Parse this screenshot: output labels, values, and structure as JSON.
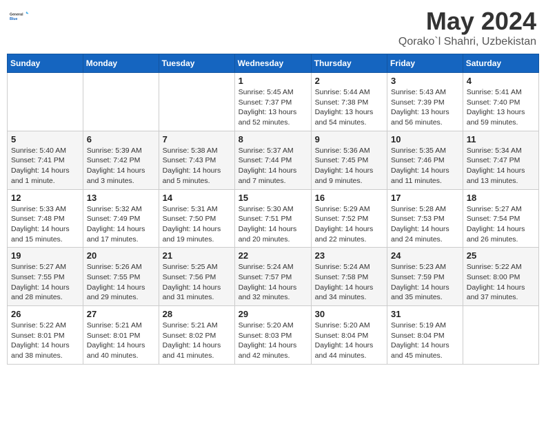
{
  "logo": {
    "line1": "General",
    "line2": "Blue"
  },
  "title": "May 2024",
  "subtitle": "Qorako`l Shahri, Uzbekistan",
  "days_header": [
    "Sunday",
    "Monday",
    "Tuesday",
    "Wednesday",
    "Thursday",
    "Friday",
    "Saturday"
  ],
  "weeks": [
    [
      {
        "num": "",
        "info": ""
      },
      {
        "num": "",
        "info": ""
      },
      {
        "num": "",
        "info": ""
      },
      {
        "num": "1",
        "info": "Sunrise: 5:45 AM\nSunset: 7:37 PM\nDaylight: 13 hours\nand 52 minutes."
      },
      {
        "num": "2",
        "info": "Sunrise: 5:44 AM\nSunset: 7:38 PM\nDaylight: 13 hours\nand 54 minutes."
      },
      {
        "num": "3",
        "info": "Sunrise: 5:43 AM\nSunset: 7:39 PM\nDaylight: 13 hours\nand 56 minutes."
      },
      {
        "num": "4",
        "info": "Sunrise: 5:41 AM\nSunset: 7:40 PM\nDaylight: 13 hours\nand 59 minutes."
      }
    ],
    [
      {
        "num": "5",
        "info": "Sunrise: 5:40 AM\nSunset: 7:41 PM\nDaylight: 14 hours\nand 1 minute."
      },
      {
        "num": "6",
        "info": "Sunrise: 5:39 AM\nSunset: 7:42 PM\nDaylight: 14 hours\nand 3 minutes."
      },
      {
        "num": "7",
        "info": "Sunrise: 5:38 AM\nSunset: 7:43 PM\nDaylight: 14 hours\nand 5 minutes."
      },
      {
        "num": "8",
        "info": "Sunrise: 5:37 AM\nSunset: 7:44 PM\nDaylight: 14 hours\nand 7 minutes."
      },
      {
        "num": "9",
        "info": "Sunrise: 5:36 AM\nSunset: 7:45 PM\nDaylight: 14 hours\nand 9 minutes."
      },
      {
        "num": "10",
        "info": "Sunrise: 5:35 AM\nSunset: 7:46 PM\nDaylight: 14 hours\nand 11 minutes."
      },
      {
        "num": "11",
        "info": "Sunrise: 5:34 AM\nSunset: 7:47 PM\nDaylight: 14 hours\nand 13 minutes."
      }
    ],
    [
      {
        "num": "12",
        "info": "Sunrise: 5:33 AM\nSunset: 7:48 PM\nDaylight: 14 hours\nand 15 minutes."
      },
      {
        "num": "13",
        "info": "Sunrise: 5:32 AM\nSunset: 7:49 PM\nDaylight: 14 hours\nand 17 minutes."
      },
      {
        "num": "14",
        "info": "Sunrise: 5:31 AM\nSunset: 7:50 PM\nDaylight: 14 hours\nand 19 minutes."
      },
      {
        "num": "15",
        "info": "Sunrise: 5:30 AM\nSunset: 7:51 PM\nDaylight: 14 hours\nand 20 minutes."
      },
      {
        "num": "16",
        "info": "Sunrise: 5:29 AM\nSunset: 7:52 PM\nDaylight: 14 hours\nand 22 minutes."
      },
      {
        "num": "17",
        "info": "Sunrise: 5:28 AM\nSunset: 7:53 PM\nDaylight: 14 hours\nand 24 minutes."
      },
      {
        "num": "18",
        "info": "Sunrise: 5:27 AM\nSunset: 7:54 PM\nDaylight: 14 hours\nand 26 minutes."
      }
    ],
    [
      {
        "num": "19",
        "info": "Sunrise: 5:27 AM\nSunset: 7:55 PM\nDaylight: 14 hours\nand 28 minutes."
      },
      {
        "num": "20",
        "info": "Sunrise: 5:26 AM\nSunset: 7:55 PM\nDaylight: 14 hours\nand 29 minutes."
      },
      {
        "num": "21",
        "info": "Sunrise: 5:25 AM\nSunset: 7:56 PM\nDaylight: 14 hours\nand 31 minutes."
      },
      {
        "num": "22",
        "info": "Sunrise: 5:24 AM\nSunset: 7:57 PM\nDaylight: 14 hours\nand 32 minutes."
      },
      {
        "num": "23",
        "info": "Sunrise: 5:24 AM\nSunset: 7:58 PM\nDaylight: 14 hours\nand 34 minutes."
      },
      {
        "num": "24",
        "info": "Sunrise: 5:23 AM\nSunset: 7:59 PM\nDaylight: 14 hours\nand 35 minutes."
      },
      {
        "num": "25",
        "info": "Sunrise: 5:22 AM\nSunset: 8:00 PM\nDaylight: 14 hours\nand 37 minutes."
      }
    ],
    [
      {
        "num": "26",
        "info": "Sunrise: 5:22 AM\nSunset: 8:01 PM\nDaylight: 14 hours\nand 38 minutes."
      },
      {
        "num": "27",
        "info": "Sunrise: 5:21 AM\nSunset: 8:01 PM\nDaylight: 14 hours\nand 40 minutes."
      },
      {
        "num": "28",
        "info": "Sunrise: 5:21 AM\nSunset: 8:02 PM\nDaylight: 14 hours\nand 41 minutes."
      },
      {
        "num": "29",
        "info": "Sunrise: 5:20 AM\nSunset: 8:03 PM\nDaylight: 14 hours\nand 42 minutes."
      },
      {
        "num": "30",
        "info": "Sunrise: 5:20 AM\nSunset: 8:04 PM\nDaylight: 14 hours\nand 44 minutes."
      },
      {
        "num": "31",
        "info": "Sunrise: 5:19 AM\nSunset: 8:04 PM\nDaylight: 14 hours\nand 45 minutes."
      },
      {
        "num": "",
        "info": ""
      }
    ]
  ]
}
